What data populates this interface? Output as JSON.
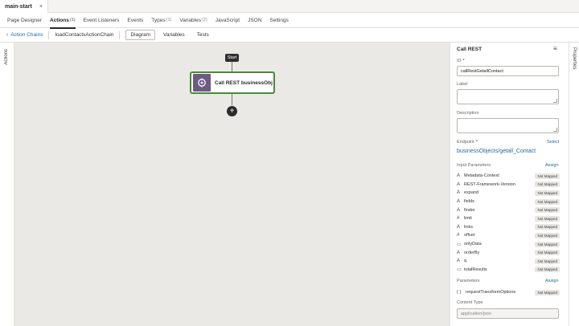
{
  "file_tab": {
    "label": "main-start",
    "close": "×"
  },
  "main_tabs": [
    {
      "label": "Page Designer",
      "count": ""
    },
    {
      "label": "Actions",
      "count": "(1)"
    },
    {
      "label": "Event Listeners",
      "count": ""
    },
    {
      "label": "Events",
      "count": ""
    },
    {
      "label": "Types",
      "count": "(1)"
    },
    {
      "label": "Variables",
      "count": "(2)"
    },
    {
      "label": "JavaScript",
      "count": ""
    },
    {
      "label": "JSON",
      "count": ""
    },
    {
      "label": "Settings",
      "count": ""
    }
  ],
  "subbar": {
    "back_label": "Action Chains",
    "chain_name": "loadContactsActionChain",
    "tabs": [
      "Diagram",
      "Variables",
      "Tests"
    ]
  },
  "left_rail": {
    "label": "Actions"
  },
  "right_rail": {
    "label": "Properties"
  },
  "diagram": {
    "start_label": "Start",
    "node_label": "Call REST businessObjects",
    "add_icon": "+"
  },
  "properties": {
    "title": "Call REST",
    "menu_icon": "≡",
    "id_label": "ID",
    "required_mark": "*",
    "id_value": "callRestGetallContact",
    "label_label": "Label",
    "description_label": "Description",
    "endpoint_label": "Endpoint",
    "select_label": "Select",
    "endpoint_value": "businessObjects/getall_Contact",
    "input_params_label": "Input Parameters",
    "assign_label": "Assign",
    "input_params": [
      {
        "type": "A",
        "name": "Metadata-Context",
        "status": "Not Mapped"
      },
      {
        "type": "A",
        "name": "REST-Framework-Version",
        "status": "Not Mapped"
      },
      {
        "type": "A",
        "name": "expand",
        "status": "Not Mapped"
      },
      {
        "type": "A",
        "name": "fields",
        "status": "Not Mapped"
      },
      {
        "type": "A",
        "name": "finder",
        "status": "Not Mapped"
      },
      {
        "type": "#",
        "name": "limit",
        "status": "Not Mapped"
      },
      {
        "type": "A",
        "name": "links",
        "status": "Not Mapped"
      },
      {
        "type": "#",
        "name": "offset",
        "status": "Not Mapped"
      },
      {
        "type": "▭",
        "name": "onlyData",
        "status": "Not Mapped"
      },
      {
        "type": "A",
        "name": "orderBy",
        "status": "Not Mapped"
      },
      {
        "type": "A",
        "name": "q",
        "status": "Not Mapped"
      },
      {
        "type": "▭",
        "name": "totalResults",
        "status": "Not Mapped"
      }
    ],
    "parameters_label": "Parameters",
    "parameters_assign_label": "Assign",
    "parameter_row": {
      "type": "{ }",
      "name": "requestTransformOptions",
      "status": "Not Mapped"
    },
    "content_type_label": "Content Type",
    "content_type_placeholder": "application/json"
  }
}
